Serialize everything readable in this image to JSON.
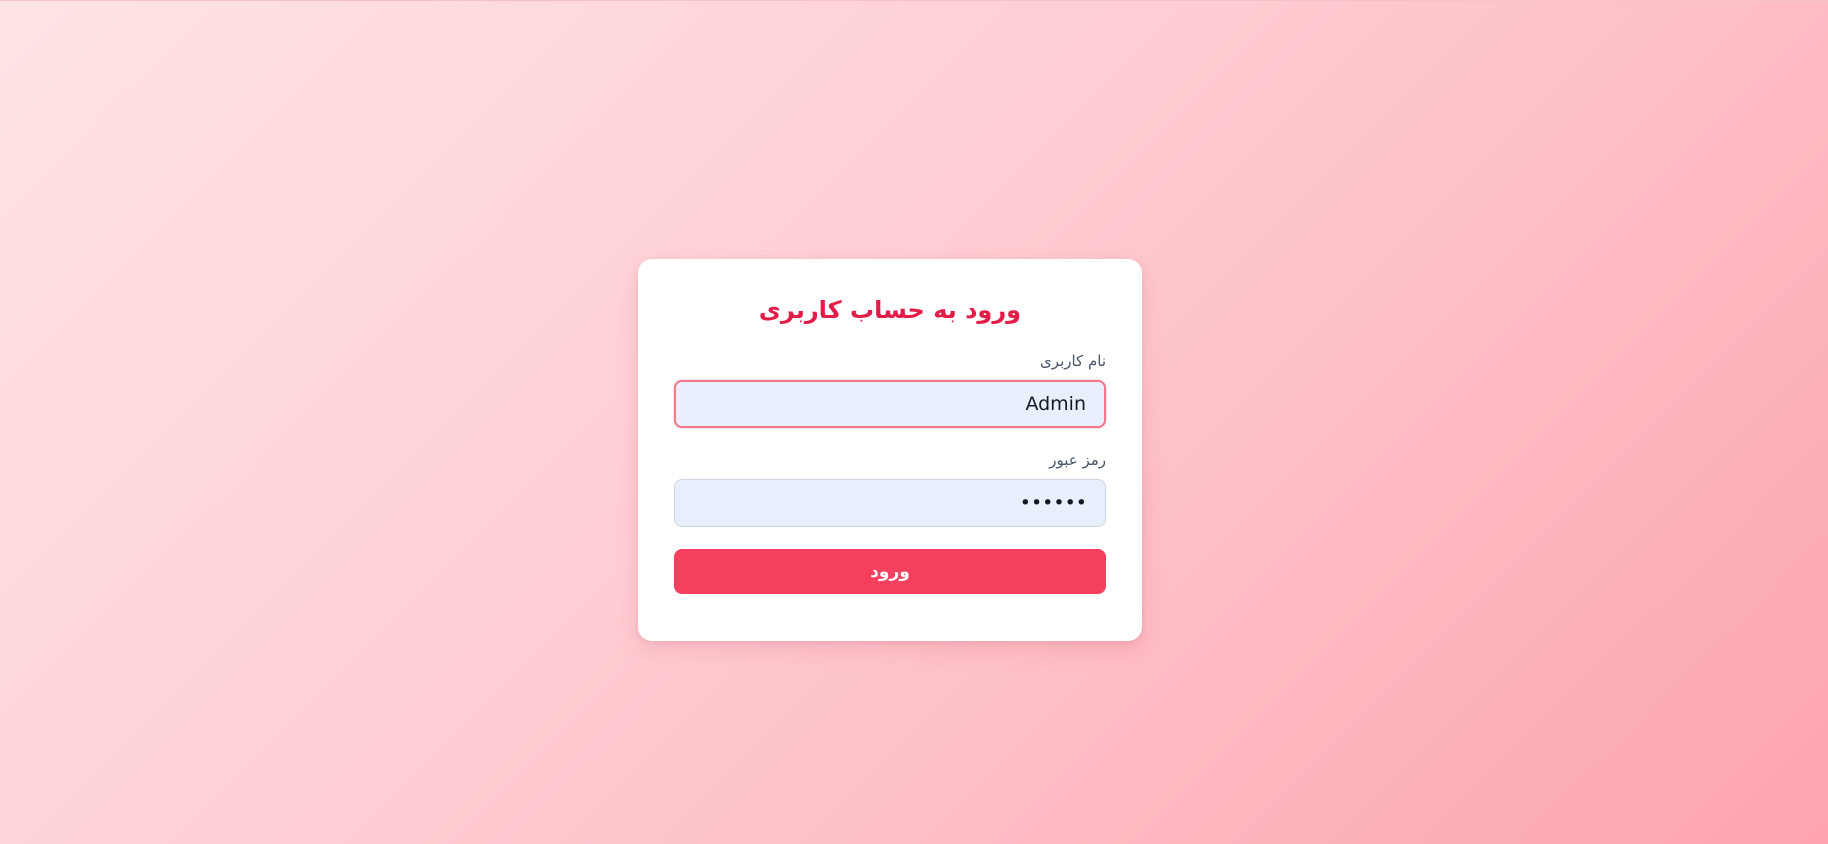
{
  "colors": {
    "accent": "#e11d48",
    "button": "#f43f5e",
    "input_bg": "#e8f0fe",
    "focus_border": "#f0778c"
  },
  "login": {
    "title": "ورود به حساب کاربری",
    "username": {
      "label": "نام کاربری",
      "value": "Admin",
      "focused": true
    },
    "password": {
      "label": "رمز عبور",
      "value": "••••••"
    },
    "submit_label": "ورود"
  }
}
